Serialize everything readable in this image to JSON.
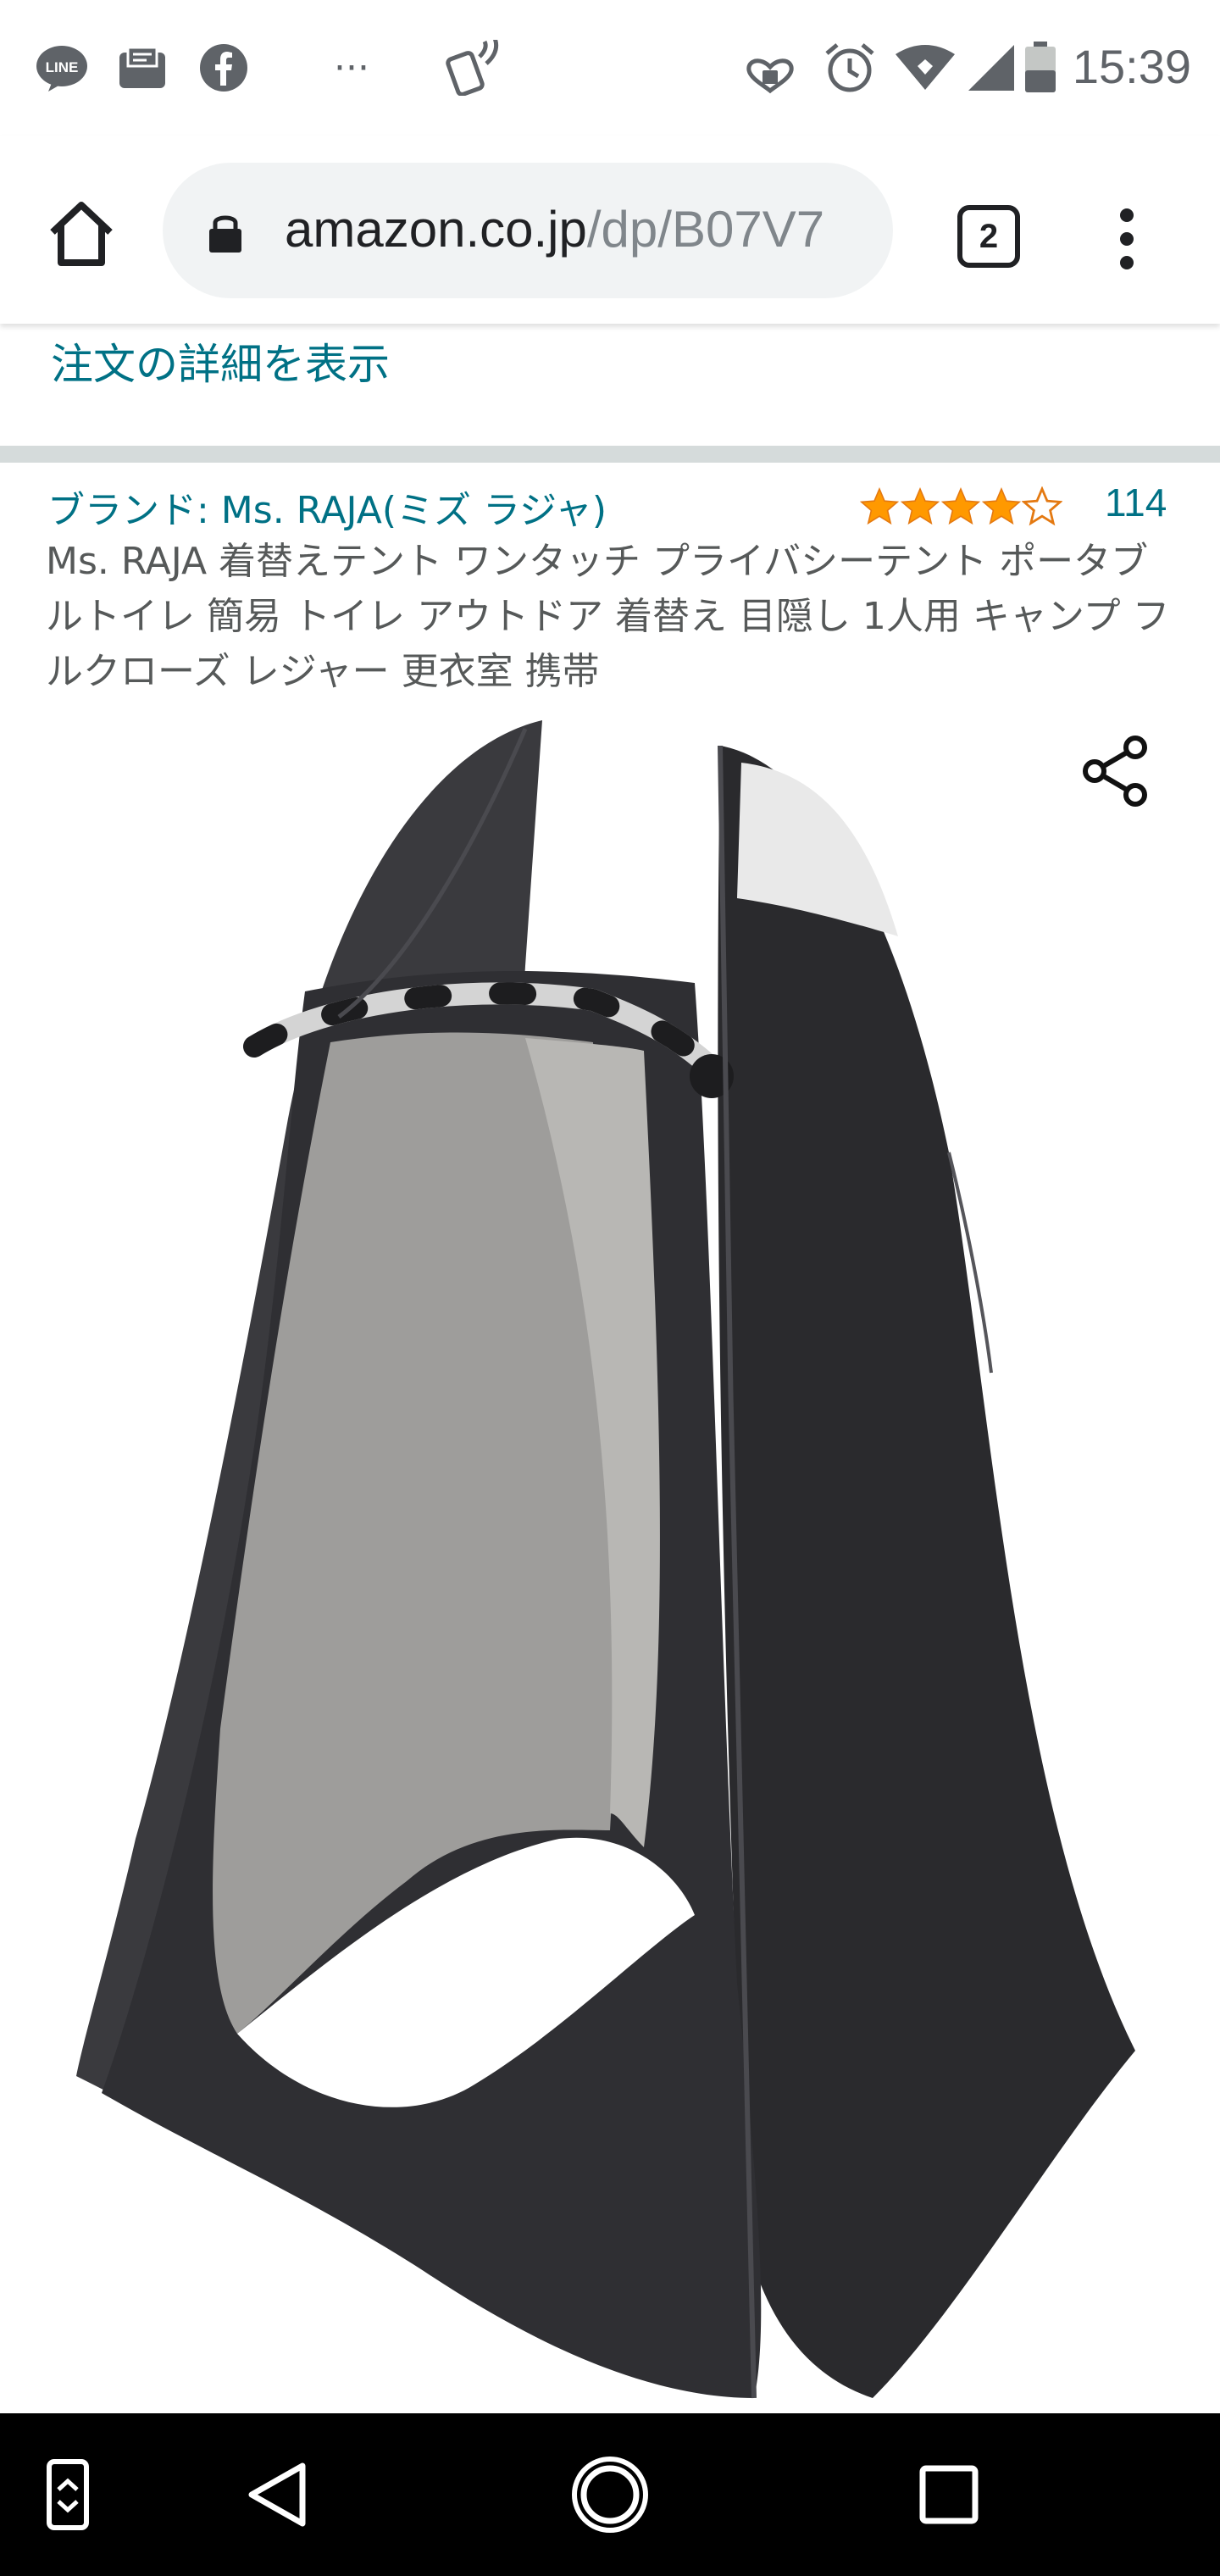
{
  "status_bar": {
    "time": "15:39",
    "left_icons": [
      "line-app-icon",
      "mail-notification-icon",
      "facebook-icon",
      "more-dots-icon",
      "nfc-icon"
    ],
    "right_icons": [
      "heart-lock-icon",
      "alarm-icon",
      "wifi-icon",
      "signal-icon",
      "battery-icon"
    ],
    "more_dots": "···"
  },
  "browser": {
    "url_host": "amazon.co.jp",
    "url_path": "/dp/B07V7",
    "tab_count": "2"
  },
  "page": {
    "order_details_link": "注文の詳細を表示",
    "brand_link": "ブランド: Ms. RAJA(ミズ ラジャ)",
    "rating_stars": 4,
    "rating_max": 5,
    "review_count": "114",
    "product_title": "Ms. RAJA 着替えテント ワンタッチ プライバシーテント ポータブルトイレ 簡易 トイレ アウトドア 着替え 目隠し 1人用 キャンプ フルクローズ レジャー 更衣室 携帯"
  },
  "colors": {
    "link": "#007185",
    "star": "#ff9900",
    "divider": "#d5dbdb",
    "tent_dark": "#2b2b2e",
    "tent_light": "#a9a9a9"
  }
}
